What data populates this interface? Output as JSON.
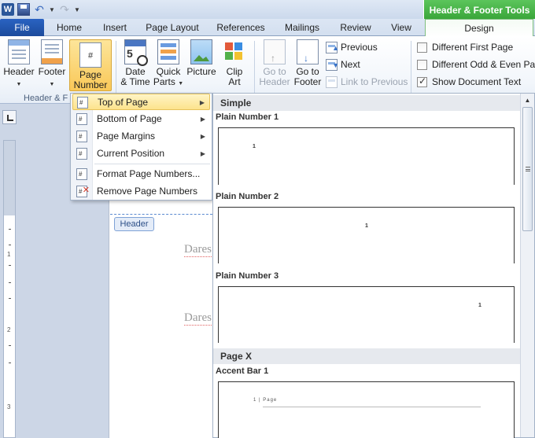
{
  "quick_access": {
    "app_icon_letter": "W",
    "icons": [
      "word-icon",
      "save-icon",
      "undo-icon",
      "redo-icon"
    ]
  },
  "contextual_tab_title": "Header & Footer Tools",
  "tabs": {
    "file": "File",
    "home": "Home",
    "insert": "Insert",
    "page_layout": "Page Layout",
    "references": "References",
    "mailings": "Mailings",
    "review": "Review",
    "view": "View",
    "design": "Design"
  },
  "ribbon": {
    "header_btn": "Header",
    "footer_btn": "Footer",
    "page_number_btn_1": "Page",
    "page_number_btn_2": "Number",
    "date_time_1": "Date",
    "date_time_2": "& Time",
    "date_time_num": "5",
    "quick_parts_1": "Quick",
    "quick_parts_2": "Parts",
    "picture": "Picture",
    "clip_art_1": "Clip",
    "clip_art_2": "Art",
    "go_to_header_1": "Go to",
    "go_to_header_2": "Header",
    "go_to_footer_1": "Go to",
    "go_to_footer_2": "Footer",
    "previous": "Previous",
    "next": "Next",
    "link_to_previous": "Link to Previous",
    "different_first_page": "Different First Page",
    "different_odd_even": "Different Odd & Even Pag",
    "show_document_text": "Show Document Text",
    "different_first_page_checked": false,
    "different_odd_even_checked": false,
    "show_document_text_checked": true,
    "group_header_footer": "Header & F"
  },
  "page_number_menu": [
    {
      "label": "Top of Page",
      "submenu": true
    },
    {
      "label": "Bottom of Page",
      "submenu": true
    },
    {
      "label": "Page Margins",
      "submenu": true
    },
    {
      "label": "Current Position",
      "submenu": true
    },
    {
      "label": "Format Page Numbers...",
      "submenu": false
    },
    {
      "label": "Remove Page Numbers",
      "submenu": false
    }
  ],
  "gallery": {
    "category_simple": "Simple",
    "plain_number_1": "Plain Number 1",
    "plain_number_2": "Plain Number 2",
    "plain_number_3": "Plain Number 3",
    "category_page_x": "Page X",
    "accent_bar_1": "Accent Bar 1",
    "sample_number": "1",
    "accent_text": "1 | Page"
  },
  "document": {
    "header_tag": "Header",
    "text_line_1": "Dares",
    "text_line_2": "Dares"
  },
  "colors": {
    "accent_blue": "#2a63c2",
    "contextual_green": "#3aa63a",
    "highlight_yellow": "#fde38c"
  }
}
